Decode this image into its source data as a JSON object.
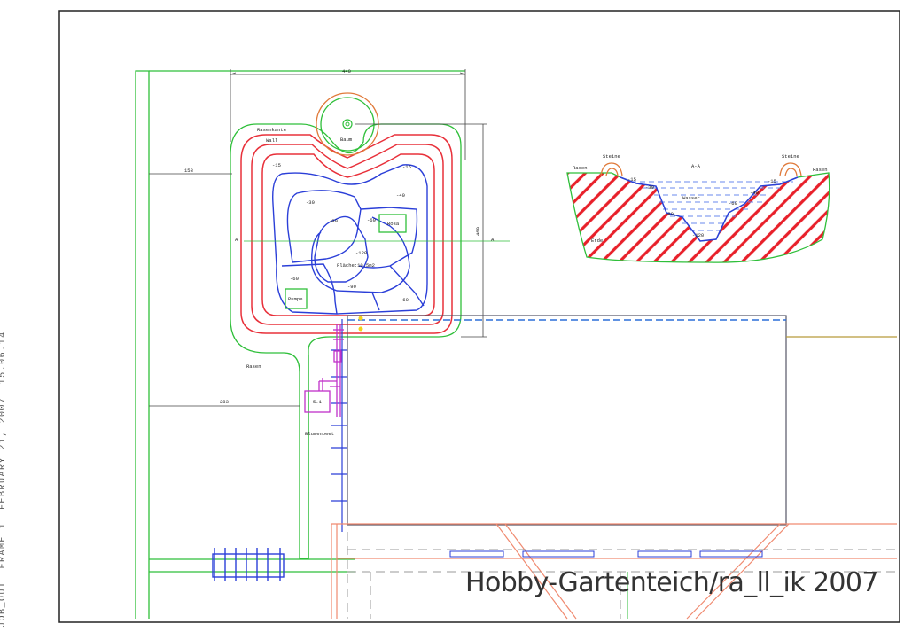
{
  "plot_meta": {
    "job": "JOB_OUT",
    "frame": "FRAME 1",
    "date": "FEBRUARY 21, 2007",
    "time": "15.06.14"
  },
  "plan": {
    "dim_width": "440",
    "dim_height": "460",
    "dim_left_top": "153",
    "dim_left_bottom": "283",
    "labels": {
      "rasenkante": "Rasenkante",
      "wall": "Wall",
      "baum": "Baum",
      "rasen": "Rasen",
      "blumenbeet": "Blumenbeet",
      "pumpe": "Pumpe",
      "rosa": "Rosa",
      "flaeche": "Fläche:10.5m2",
      "box_51": "5.1",
      "section_a_left": "A",
      "section_a_right": "A"
    },
    "depths": {
      "d15_left": "-15",
      "d15_right": "-15",
      "d30": "-30",
      "d40": "-40",
      "d80": "-80",
      "d60_top": "-60",
      "d120": "-120",
      "d60_left": "-60",
      "d90": "-90",
      "d60_right": "-60"
    }
  },
  "section": {
    "title": "A-A",
    "rasen_left": "Rasen",
    "rasen_right": "Rasen",
    "steine_left": "Steine",
    "steine_right": "Steine",
    "wasser": "Wasser",
    "erde": "Erde",
    "depths": {
      "l15": "-15",
      "l30": "-30",
      "l80": "-80",
      "b120": "-120",
      "r60": "-60",
      "r40": "-40",
      "r15": "-15"
    }
  },
  "watermark": "Hobby-Gartenteich/ra_ll_ik 2007"
}
